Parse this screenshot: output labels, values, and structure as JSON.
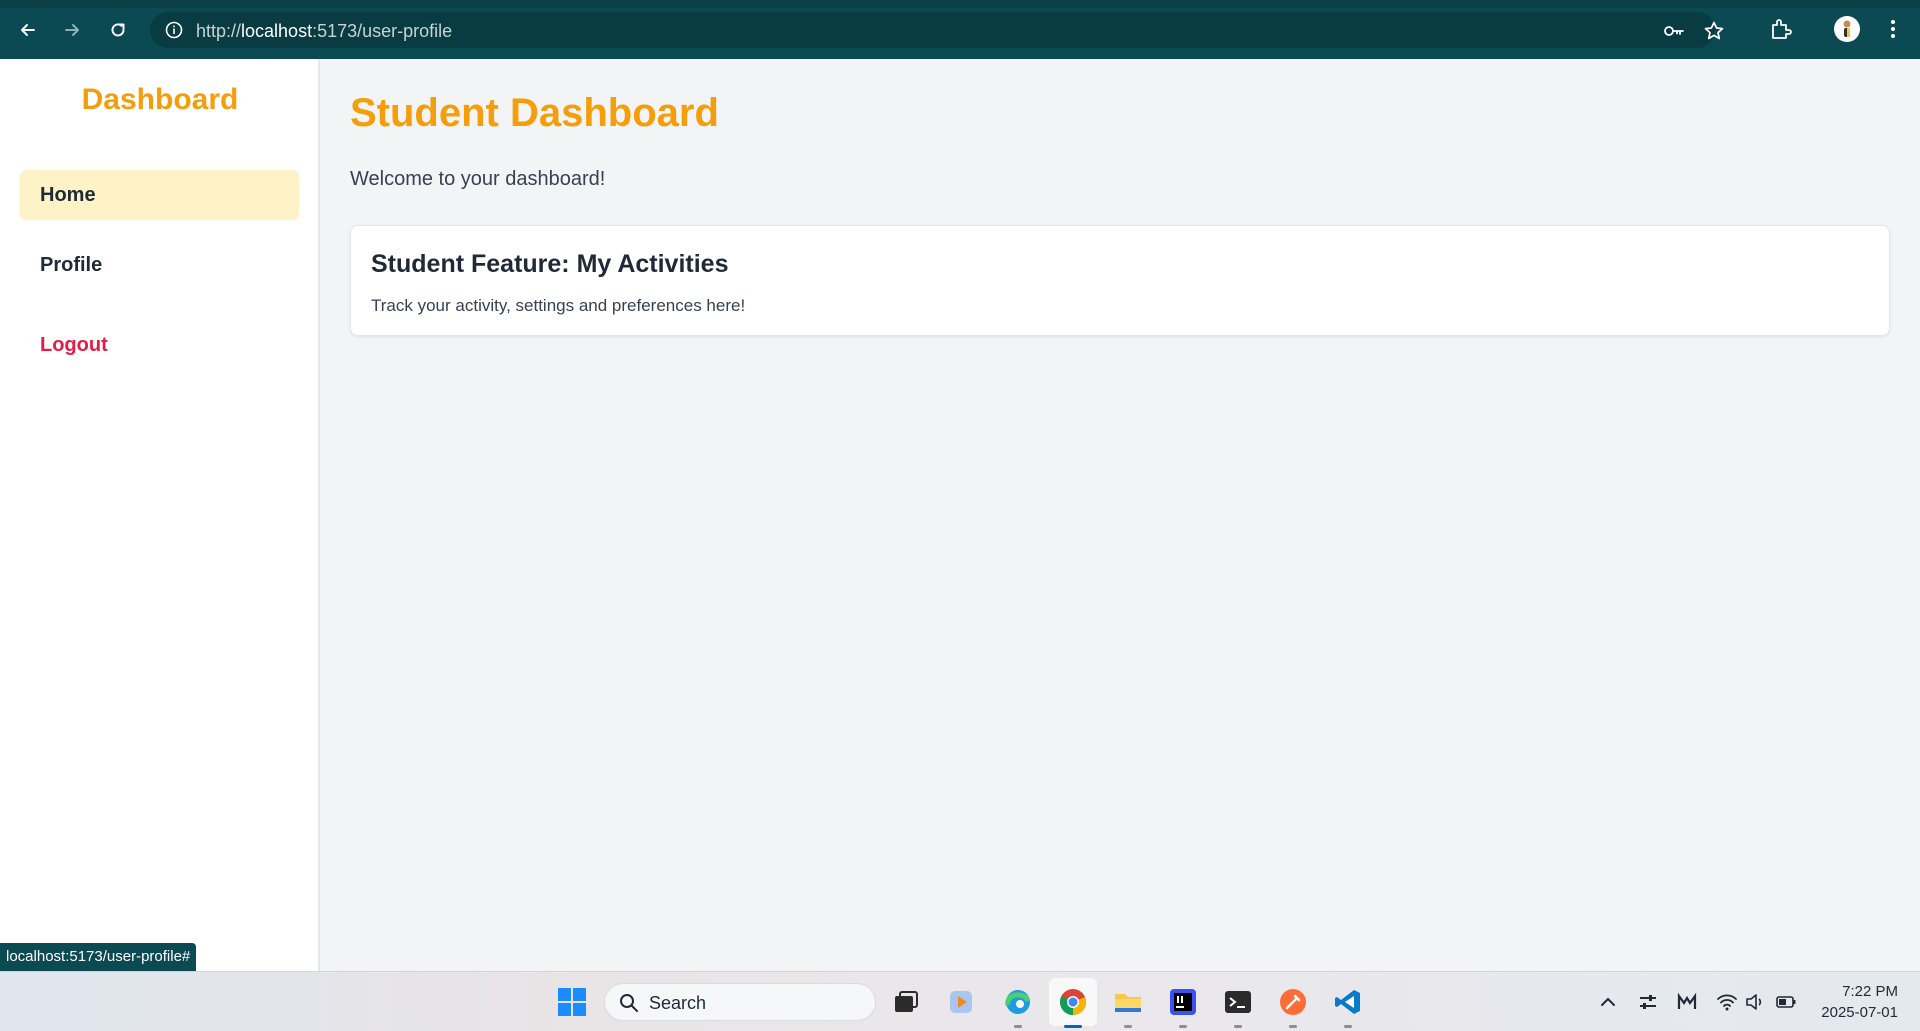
{
  "browser": {
    "url_prefix": "http://",
    "url_host": "localhost",
    "url_path": ":5173/user-profile"
  },
  "sidebar": {
    "brand": "Dashboard",
    "items": [
      {
        "label": "Home",
        "active": true
      },
      {
        "label": "Profile",
        "active": false
      },
      {
        "label": "Logout",
        "active": false
      }
    ]
  },
  "main": {
    "title": "Student Dashboard",
    "welcome": "Welcome to your dashboard!",
    "card": {
      "title": "Student Feature: My Activities",
      "text": "Track your activity, settings and preferences here!"
    }
  },
  "status_bar": {
    "hover_url": "localhost:5173/user-profile#"
  },
  "taskbar": {
    "search_label": "Search",
    "time": "7:22 PM",
    "date": "2025-07-01"
  },
  "colors": {
    "accent": "#f59e0b",
    "active_item_bg": "#fef3c7",
    "logout": "#e11d48",
    "browser_chrome": "#0b4a52"
  }
}
